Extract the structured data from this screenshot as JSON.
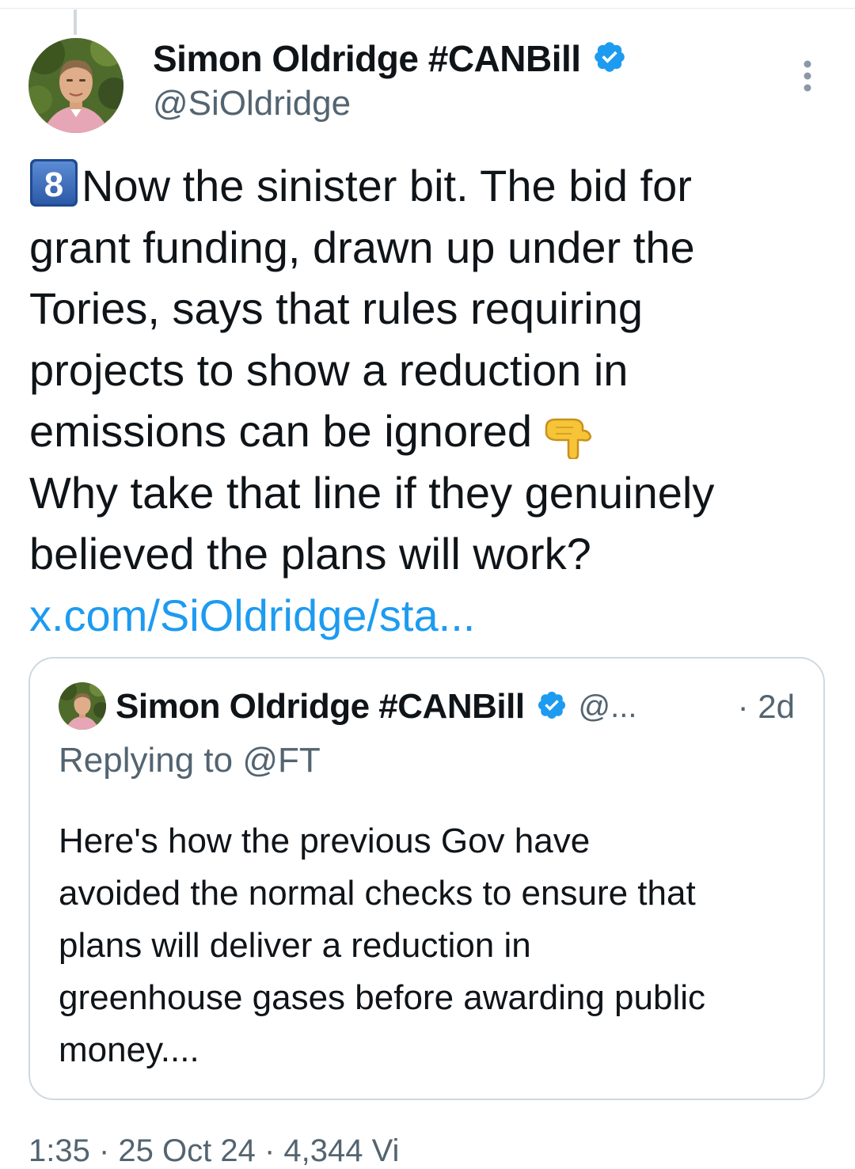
{
  "tweet": {
    "author_name": "Simon Oldridge #CANBill",
    "author_handle": "@SiOldridge",
    "keycap_number": "8",
    "body_lines": [
      "Now the sinister bit. The bid for",
      "grant funding, drawn up under the",
      "Tories, says that rules requiring",
      "projects to show a reduction in",
      "emissions can be ignored",
      "Why take that line if they genuinely",
      "believed the plans will work?"
    ],
    "link_text": "x.com/SiOldridge/sta...",
    "pointing_emoji": "backhand-index-pointing-down",
    "verified_color": "#1d9bf0"
  },
  "quoted_tweet": {
    "author_name": "Simon Oldridge #CANBill",
    "author_handle": "@...",
    "timestamp": "· 2d",
    "replying_to": "Replying to @FT",
    "body_lines": [
      "Here's how the previous Gov have",
      "avoided the normal checks to ensure that",
      "plans will deliver a reduction in",
      "greenhouse gases before awarding public",
      "money...."
    ]
  },
  "footer": {
    "meta_text": "1:35 · 25 Oct 24 · 4,344 Vi"
  },
  "colors": {
    "text_primary": "#0f1419",
    "text_secondary": "#536471",
    "link": "#1d9bf0",
    "border": "#cfd9de"
  }
}
